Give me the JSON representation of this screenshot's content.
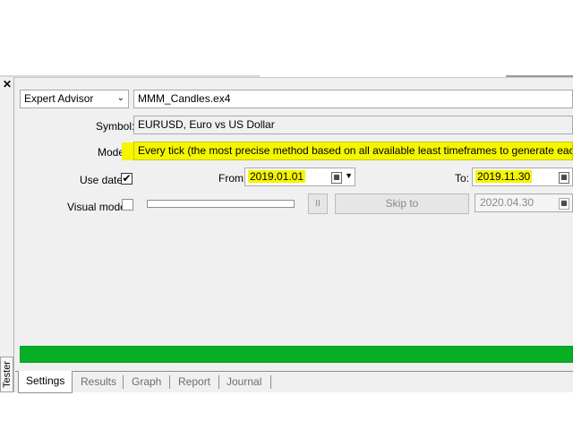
{
  "window": {
    "close_glyph": "✕",
    "vertical_tab": "Tester"
  },
  "expert": {
    "type_selected": "Expert Advisor",
    "file": "MMM_Candles.ex4"
  },
  "symbol": {
    "label": "Symbol:",
    "value": "EURUSD, Euro vs US Dollar"
  },
  "model": {
    "label": "Model:",
    "value": "Every tick (the most precise method based on all available least timeframes to generate each tick)"
  },
  "use_date": {
    "label": "Use date",
    "checked": "✔",
    "from_label": "From:",
    "from_value": "2019.01.01",
    "to_label": "To:",
    "to_value": "2019.11.30"
  },
  "visual": {
    "label": "Visual mode",
    "pause_label": "II",
    "skip_label": "Skip to",
    "skip_date": "2020.04.30"
  },
  "progress": {
    "fraction": 1.0,
    "color": "#06b025"
  },
  "highlight_color": "#f5f500",
  "tabs": [
    {
      "label": "Settings",
      "active": true
    },
    {
      "label": "Results",
      "active": false
    },
    {
      "label": "Graph",
      "active": false
    },
    {
      "label": "Report",
      "active": false
    },
    {
      "label": "Journal",
      "active": false
    }
  ],
  "icons": {
    "calendar": "calendar-icon",
    "dropdown": "chevron-down-icon",
    "checkmark": "checkmark-icon"
  }
}
